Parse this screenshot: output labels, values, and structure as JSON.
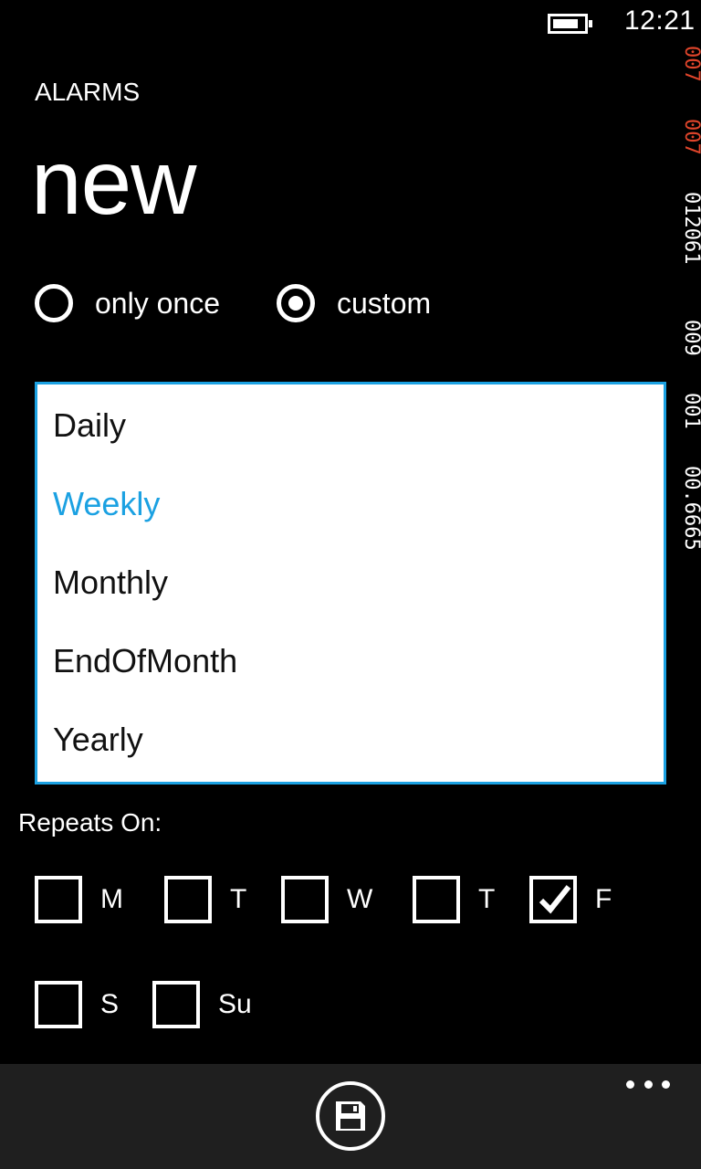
{
  "status_bar": {
    "time": "12:21",
    "battery_level": 0.85
  },
  "side_counters": {
    "values": [
      "007",
      "007",
      "012061",
      "009",
      "001",
      "00.6665"
    ],
    "accent_color": "#e0452b"
  },
  "header": {
    "app_title": "ALARMS",
    "page_title": "new"
  },
  "recurrence": {
    "options": [
      {
        "label": "only once",
        "checked": false
      },
      {
        "label": "custom",
        "checked": true
      }
    ]
  },
  "frequency_list": {
    "items": [
      "Daily",
      "Weekly",
      "Monthly",
      "EndOfMonth",
      "Yearly"
    ],
    "selected": "Weekly",
    "accent_color": "#1ba1e2"
  },
  "repeats": {
    "label": "Repeats On:",
    "days": [
      {
        "label": "M",
        "checked": false
      },
      {
        "label": "T",
        "checked": false
      },
      {
        "label": "W",
        "checked": false
      },
      {
        "label": "T",
        "checked": false
      },
      {
        "label": "F",
        "checked": true
      },
      {
        "label": "S",
        "checked": false
      },
      {
        "label": "Su",
        "checked": false
      }
    ]
  },
  "app_bar": {
    "save_icon": "save-icon",
    "more_icon": "ellipsis-icon"
  }
}
